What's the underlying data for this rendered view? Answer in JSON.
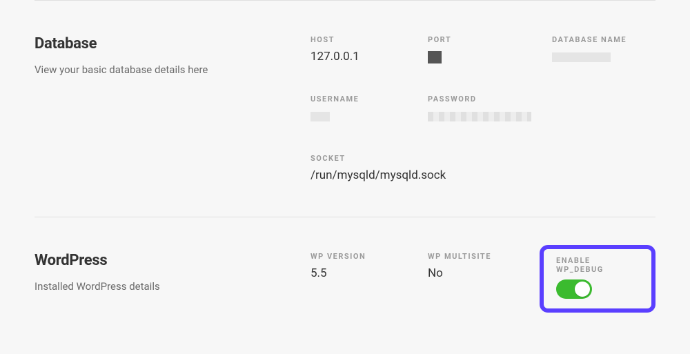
{
  "database": {
    "title": "Database",
    "description": "View your basic database details here",
    "fields": {
      "host": {
        "label": "HOST",
        "value": "127.0.0.1"
      },
      "port": {
        "label": "PORT",
        "value": ""
      },
      "db_name": {
        "label": "DATABASE NAME",
        "value": ""
      },
      "username": {
        "label": "USERNAME",
        "value": ""
      },
      "password": {
        "label": "PASSWORD",
        "value": ""
      },
      "socket": {
        "label": "SOCKET",
        "value": "/run/mysqld/mysqld.sock"
      }
    }
  },
  "wordpress": {
    "title": "WordPress",
    "description": "Installed WordPress details",
    "fields": {
      "wp_version": {
        "label": "WP VERSION",
        "value": "5.5"
      },
      "wp_multisite": {
        "label": "WP MULTISITE",
        "value": "No"
      },
      "wp_debug": {
        "label": "ENABLE WP_DEBUG",
        "enabled": true
      }
    }
  }
}
